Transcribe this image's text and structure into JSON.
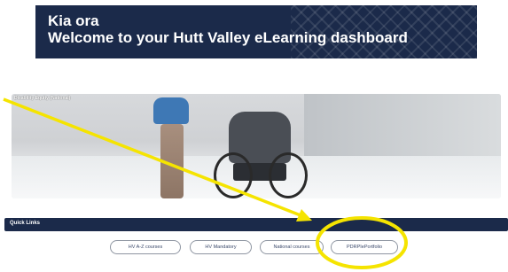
{
  "banner": {
    "line1": "Kia ora",
    "line2": "Welcome to your Hutt Valley eLearning dashboard"
  },
  "hero": {
    "label": "Disability Equity (National)"
  },
  "quick_links": {
    "title": "Quick Links",
    "buttons": [
      "HV A-Z courses",
      "HV Mandatory",
      "National courses",
      "PDRPIePortfolio"
    ]
  },
  "colors": {
    "navy": "#1b2a4a",
    "annotation_yellow": "#f5e400"
  }
}
